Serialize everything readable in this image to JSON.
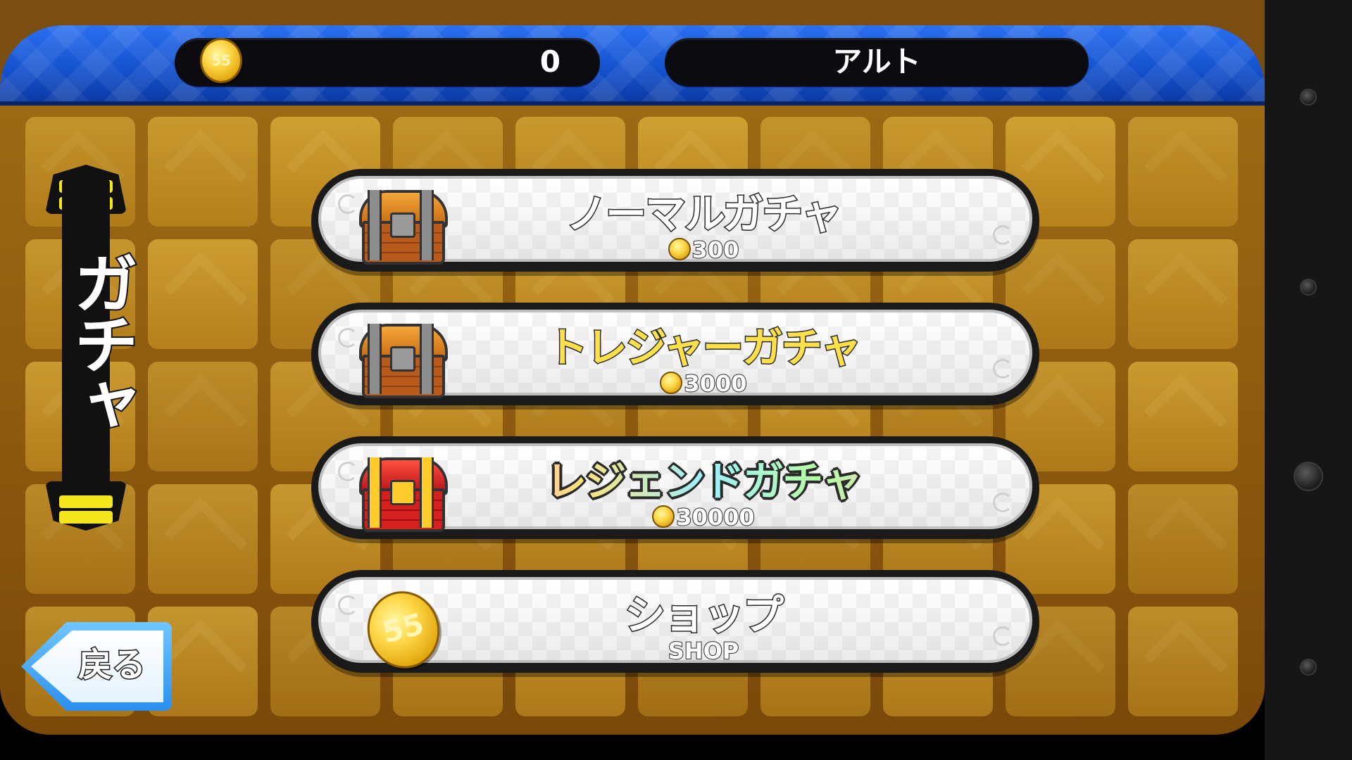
{
  "header": {
    "coin_count": "0",
    "player_name": "アルト",
    "coin_icon_text": "55"
  },
  "side_banner": {
    "label": "ガチャ"
  },
  "menu": [
    {
      "title": "ノーマルガチャ",
      "price": "300",
      "icon": "treasure-chest-wood-icon"
    },
    {
      "title": "トレジャーガチャ",
      "price": "3000",
      "icon": "treasure-chest-wood-icon"
    },
    {
      "title": "レジェンドガチャ",
      "price": "30000",
      "icon": "treasure-chest-red-gold-icon"
    },
    {
      "title": "ショップ",
      "subtitle": "SHOP",
      "icon": "gold-coin-icon",
      "icon_text": "55"
    }
  ],
  "back_button": {
    "label": "戻る"
  },
  "colors": {
    "header_blue": "#1451cc",
    "board_gold": "#9c6a14",
    "treasure_title": "#ffe04a",
    "back_button_blue": "#2a8ff0"
  }
}
